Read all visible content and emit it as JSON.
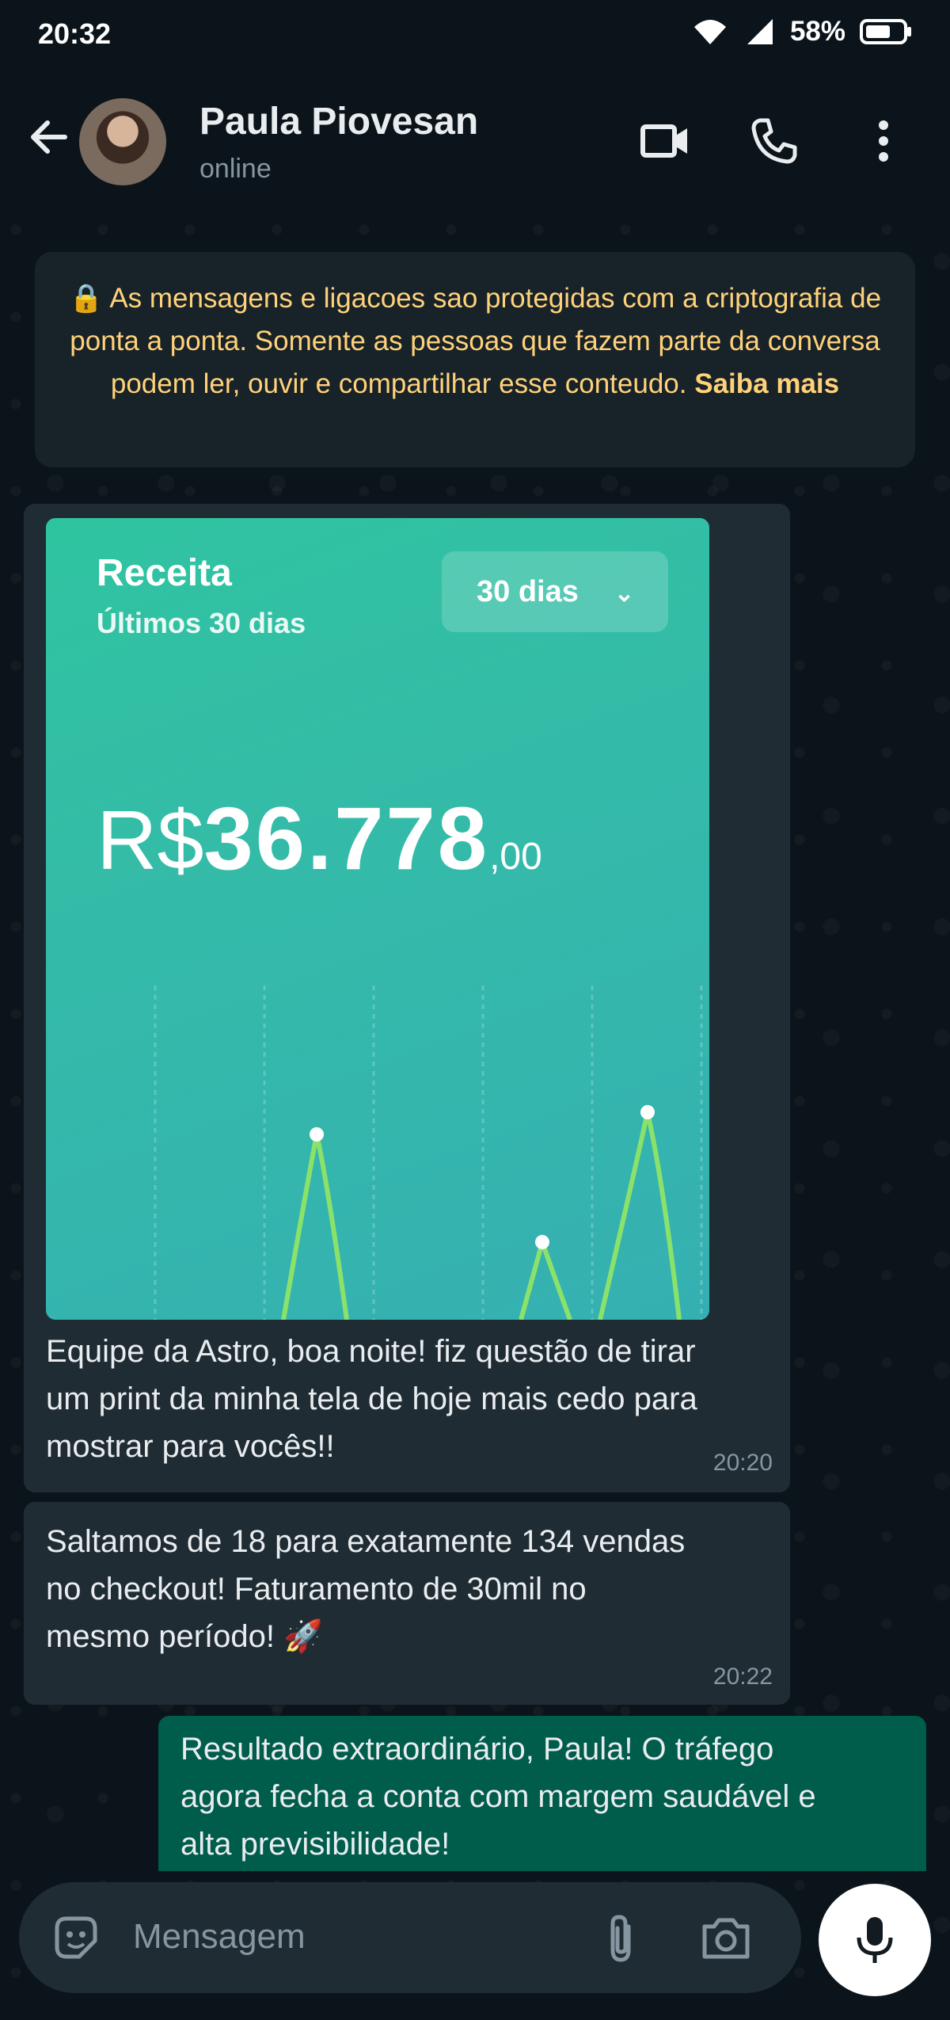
{
  "status_bar": {
    "time": "20:32",
    "battery": "58%"
  },
  "header": {
    "name": "Paula Piovesan",
    "status": "online"
  },
  "notice": {
    "text": "As mensagens e ligacoes sao protegidas com a criptografia de ponta a ponta. Somente as pessoas que fazem parte da conversa podem ler, ouvir e compartilhar esse conteudo.",
    "link": "Saiba mais"
  },
  "image_card": {
    "title": "Receita",
    "subtitle": "Últimos 30 dias",
    "select_value": "30 dias",
    "currency": "R$",
    "amount": "36.778",
    "cents": ",00"
  },
  "messages": [
    {
      "direction": "in",
      "text": [
        "Equipe da Astro, boa noite! fiz questão de tirar",
        "um print da minha tela de hoje mais cedo para",
        "mostrar para vocês!!"
      ],
      "time": "20:20"
    },
    {
      "direction": "in",
      "text": [
        "Saltamos de 18 para exatamente 134 vendas",
        "no checkout! Faturamento de 30mil no",
        "mesmo período! 🚀"
      ],
      "time": "20:22"
    },
    {
      "direction": "out",
      "text": [
        "Resultado extraordinário, Paula! O tráfego",
        "agora fecha a conta com margem saudável e",
        "alta previsibilidade!"
      ]
    }
  ],
  "composer": {
    "placeholder": "Mensagem"
  },
  "colors": {
    "incoming": "#202c33",
    "outgoing": "#005c4b",
    "background": "#0b141a",
    "notice_text": "#ffd279"
  }
}
